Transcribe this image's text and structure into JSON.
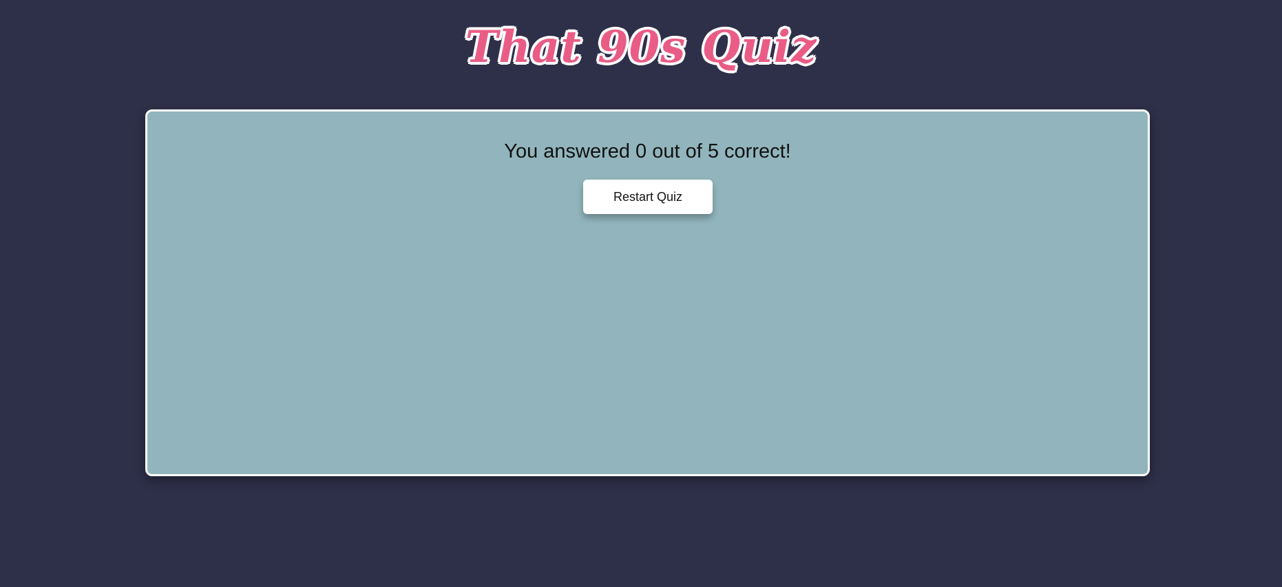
{
  "header": {
    "title": "That 90s Quiz"
  },
  "quiz": {
    "result_text": "You answered 0 out of 5 correct!",
    "correct_count": 0,
    "total_questions": 5,
    "restart_label": "Restart Quiz"
  },
  "colors": {
    "background": "#2e2f48",
    "card": "#92b5bd",
    "title_pink": "#e95c86",
    "button": "#ffffff"
  }
}
